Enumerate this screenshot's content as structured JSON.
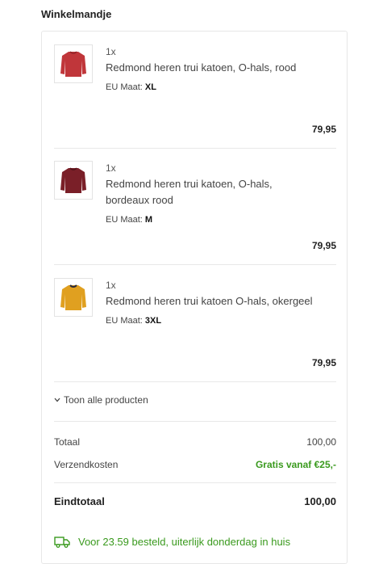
{
  "cart": {
    "title": "Winkelmandje",
    "items": [
      {
        "quantity": "1x",
        "name": "Redmond heren trui katoen, O-hals, rood",
        "size_label": "EU Maat:",
        "size_value": "XL",
        "price": "79,95",
        "color": "#c0363a"
      },
      {
        "quantity": "1x",
        "name": "Redmond heren trui katoen, O-hals, bordeaux rood",
        "size_label": "EU Maat:",
        "size_value": "M",
        "price": "79,95",
        "color": "#7a1f28"
      },
      {
        "quantity": "1x",
        "name": "Redmond heren trui katoen O-hals, okergeel",
        "size_label": "EU Maat:",
        "size_value": "3XL",
        "price": "79,95",
        "color": "#e0a020"
      }
    ],
    "show_all_label": "Toon alle producten",
    "subtotal_label": "Totaal",
    "subtotal_value": "100,00",
    "shipping_label": "Verzendkosten",
    "shipping_value": "Gratis vanaf €25,-",
    "total_label": "Eindtotaal",
    "total_value": "100,00",
    "delivery_text": "Voor 23.59 besteld, uiterlijk donderdag in huis"
  },
  "colors": {
    "accent_green": "#3a9a1e"
  }
}
